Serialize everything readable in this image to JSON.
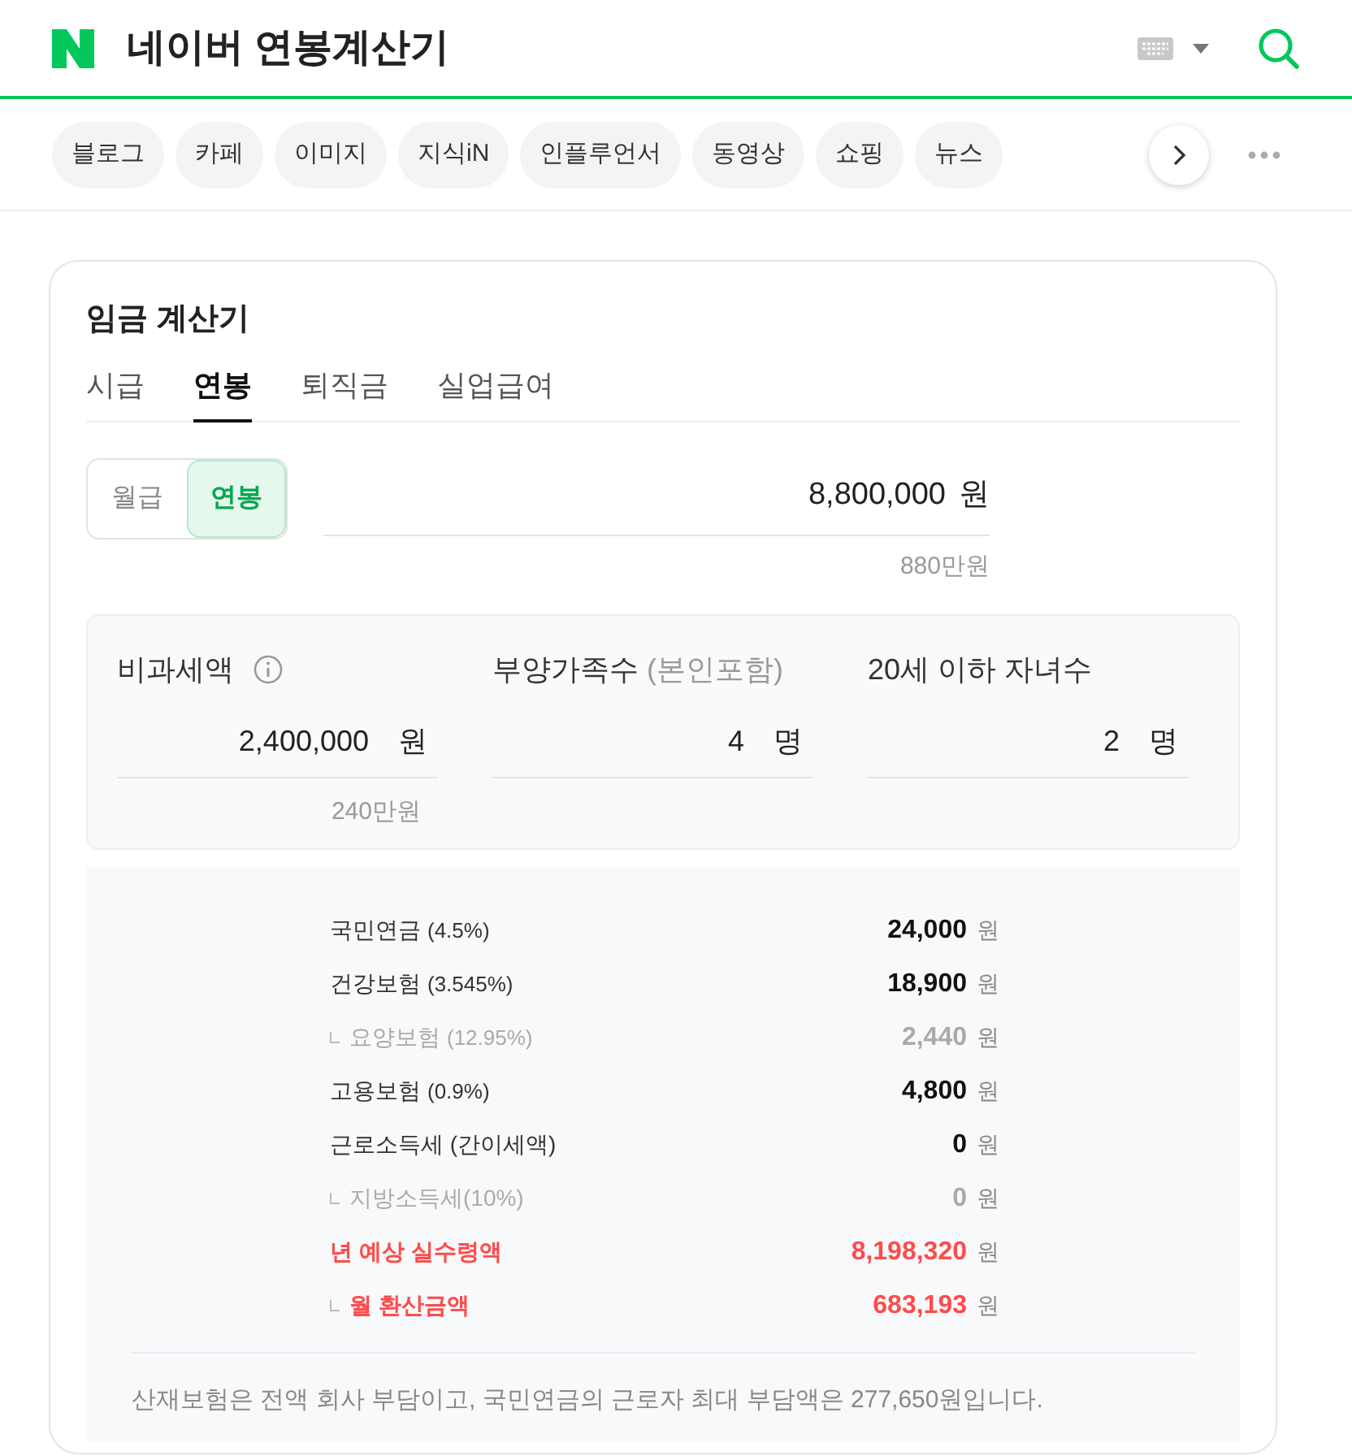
{
  "header": {
    "title": "네이버 연봉계산기"
  },
  "chips": [
    {
      "label": "블로그"
    },
    {
      "label": "카페"
    },
    {
      "label": "이미지"
    },
    {
      "label": "지식iN"
    },
    {
      "label": "인플루언서"
    },
    {
      "label": "동영상"
    },
    {
      "label": "쇼핑"
    },
    {
      "label": "뉴스"
    }
  ],
  "card": {
    "title": "임금 계산기",
    "tabs": [
      {
        "label": "시급",
        "selected": false
      },
      {
        "label": "연봉",
        "selected": true
      },
      {
        "label": "퇴직금",
        "selected": false
      },
      {
        "label": "실업급여",
        "selected": false
      }
    ],
    "period_toggle": [
      {
        "label": "월급",
        "selected": false
      },
      {
        "label": "연봉",
        "selected": true
      }
    ],
    "salary": {
      "value": "8,800,000",
      "unit": "원",
      "hint": "880만원"
    },
    "fields": [
      {
        "label": "비과세액",
        "value": "2,400,000",
        "unit": "원",
        "hint": "240만원",
        "info": true
      },
      {
        "label": "부양가족수",
        "note": "(본인포함)",
        "value": "4",
        "unit": "명"
      },
      {
        "label": "20세 이하 자녀수",
        "value": "2",
        "unit": "명"
      }
    ],
    "results": [
      {
        "label": "국민연금",
        "rate": "(4.5%)",
        "value": "24,000",
        "unit": "원",
        "kind": "main"
      },
      {
        "label": "건강보험",
        "rate": "(3.545%)",
        "value": "18,900",
        "unit": "원",
        "kind": "main"
      },
      {
        "label": "요양보험",
        "rate": "(12.95%)",
        "value": "2,440",
        "unit": "원",
        "kind": "sub"
      },
      {
        "label": "고용보험",
        "rate": "(0.9%)",
        "value": "4,800",
        "unit": "원",
        "kind": "main"
      },
      {
        "label": "근로소득세 (간이세액)",
        "value": "0",
        "unit": "원",
        "kind": "main"
      },
      {
        "label": "지방소득세(10%)",
        "value": "0",
        "unit": "원",
        "kind": "sub"
      },
      {
        "label": "년 예상 실수령액",
        "value": "8,198,320",
        "unit": "원",
        "kind": "total"
      },
      {
        "label": "월 환산금액",
        "value": "683,193",
        "unit": "원",
        "kind": "subtotal"
      }
    ],
    "footnote": "산재보험은 전액 회사 부담이고, 국민연금의 근로자 최대 부담액은 277,650원입니다."
  }
}
